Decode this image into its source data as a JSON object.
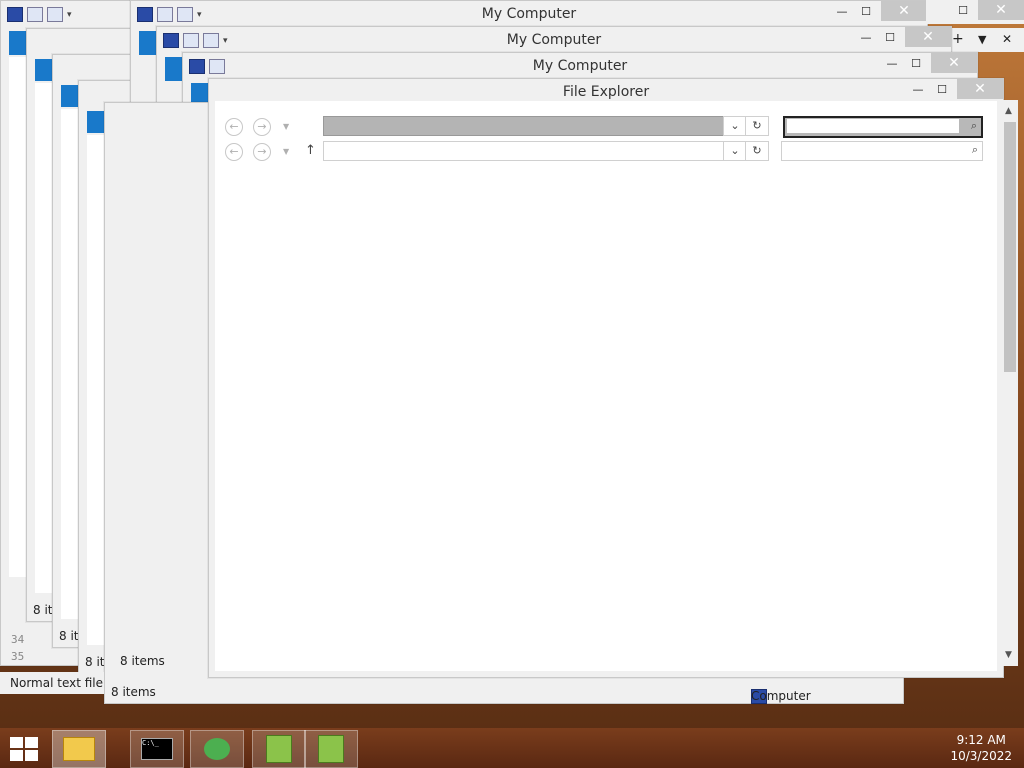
{
  "windows": {
    "back_title_1": "My Computer",
    "back_title_2": "My Computer",
    "back_title_3": "My Computer",
    "front_title": "File Explorer"
  },
  "status": {
    "items_count": "8 items",
    "items_trunc": "8 it",
    "computer_label": "Computer",
    "editor_status": "Normal text file",
    "line_numbers": [
      "34",
      "35"
    ],
    "stray_8": "8"
  },
  "controls": {
    "minimize": "—",
    "maximize": "☐",
    "close": "✕",
    "new_tab": "+",
    "tab_menu": "▼",
    "tab_close": "✕"
  },
  "taskbar": {
    "time": "9:12 AM",
    "date": "10/3/2022"
  },
  "colors": {
    "accent_blue": "#1979ca",
    "close_gray": "#c7c7c7"
  }
}
